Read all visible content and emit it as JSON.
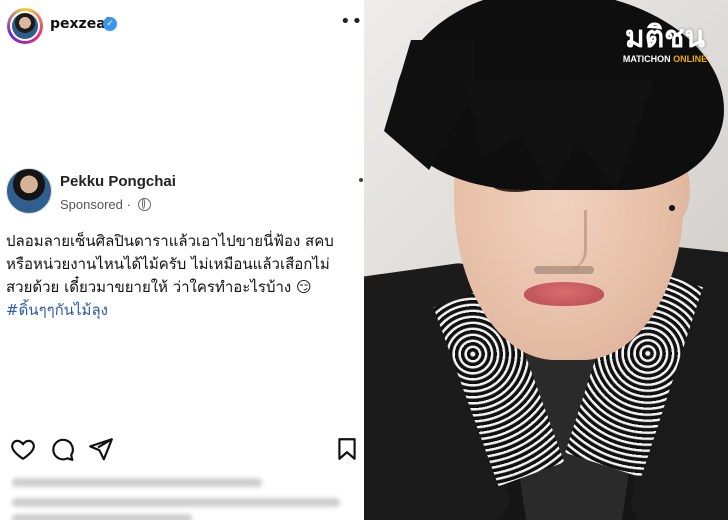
{
  "header": {
    "username": "pexzeal",
    "verified_icon": "verified-badge-icon",
    "more_icon": "more-horizontal-icon",
    "more_label": "•••"
  },
  "post": {
    "display_name": "Pekku Pongchai",
    "sponsored_label": "Sponsored · ",
    "caption_lines": [
      "ปลอมลายเซ็นศิลปินดาราแล้วเอาไปขายนี่ฟ้อง สคบ",
      "หรือหน่วยงานไหนได้ไม้ครับ ไม่เหมือนแล้วเสือกไม่",
      "สวยด้วย เดี๋ยวมาขยายให้ ว่าใครทำอะไรบ้าง 😏"
    ],
    "hashtag": "#ดิ้นๆๆกันไม้ลุง",
    "hashtag_color": "#2a5aa8"
  },
  "actions": {
    "like_icon": "heart-icon",
    "comment_icon": "comment-icon",
    "share_icon": "send-icon",
    "save_icon": "bookmark-icon"
  },
  "watermark": {
    "main": "มติชน",
    "sub_left": "MATICHON ",
    "sub_right": "ONLINE",
    "accent_color": "#f2a900"
  }
}
